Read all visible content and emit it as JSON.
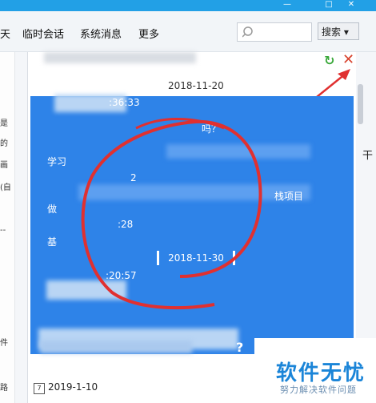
{
  "window_controls": [
    "—",
    "□",
    "✕"
  ],
  "menu": [
    {
      "label": "天"
    },
    {
      "label": "临时会话"
    },
    {
      "label": "系统消息"
    },
    {
      "label": "更多"
    }
  ],
  "search": {
    "placeholder": "",
    "button_label": "搜索 ▾"
  },
  "left_chars": [
    "是",
    "的",
    "画",
    "(自",
    "--",
    "件",
    "路"
  ],
  "history": {
    "top_date": "2018-11-20",
    "messages": [
      {
        "text": ":36:33"
      },
      {
        "text": "吗？"
      },
      {
        "text": "学习"
      },
      {
        "text": "2"
      },
      {
        "text": "栈项目"
      },
      {
        "text": "做"
      },
      {
        "text": ":28"
      },
      {
        "text": "基"
      },
      {
        "text": ":20:57"
      }
    ],
    "middle_date": "2018-11-30",
    "footer_date": "2019-1-10",
    "cal_day": "7",
    "qmark": "?"
  },
  "right_edge_char": "干",
  "watermark": {
    "main": "软件无忧",
    "sub": "努力解决软件问题"
  },
  "colors": {
    "accent": "#22a0e6",
    "chat_blue": "#2e83e8",
    "annotation_red": "#e03030"
  }
}
